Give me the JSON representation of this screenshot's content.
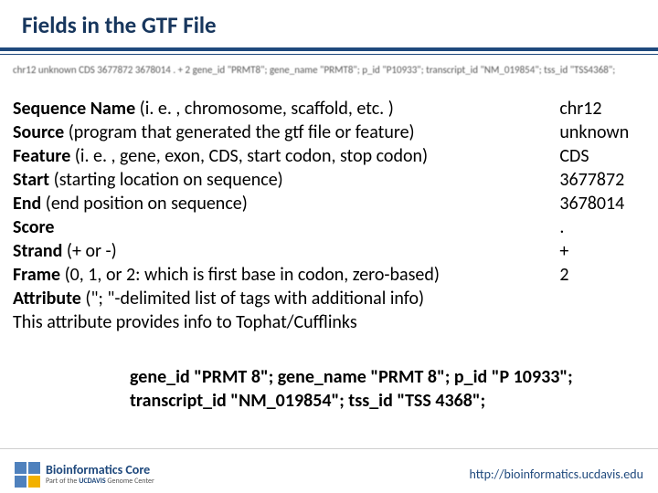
{
  "title": "Fields in the GTF File",
  "example_row": "chr12    unknown  CDS      3677872   3678014   .    +    2    gene_id \"PRMT8\"; gene_name \"PRMT8\"; p_id \"P10933\"; transcript_id \"NM_019854\"; tss_id \"TSS4368\";",
  "fields": [
    {
      "name": "Sequence Name",
      "desc": " (i. e. , chromosome, scaffold, etc. )",
      "value": "chr12"
    },
    {
      "name": "Source",
      "desc": " (program that generated the gtf file or feature)",
      "value": "unknown"
    },
    {
      "name": "Feature",
      "desc": " (i. e. , gene, exon, CDS, start codon, stop codon)",
      "value": "CDS"
    },
    {
      "name": "Start",
      "desc": " (starting location on sequence)",
      "value": "3677872"
    },
    {
      "name": "End",
      "desc": " (end position on sequence)",
      "value": "3678014"
    },
    {
      "name": "Score",
      "desc": "",
      "value": "."
    },
    {
      "name": "Strand",
      "desc": " (+ or -)",
      "value": "+"
    },
    {
      "name": "Frame",
      "desc": " (0, 1, or 2: which is first base in codon, zero-based)",
      "value": "2"
    },
    {
      "name": "Attribute",
      "desc": " (\"; \"-delimited list of tags with additional info)",
      "value": ""
    }
  ],
  "attribute_note": "This attribute provides info to Tophat/Cufflinks",
  "attribute_block_line1": "gene_id \"PRMT 8\"; gene_name \"PRMT 8\"; p_id \"P 10933\";",
  "attribute_block_line2": "transcript_id \"NM_019854\"; tss_id \"TSS 4368\";",
  "footer": {
    "logo_line1": "Bioinformatics Core",
    "logo_line2_a": "Part of the ",
    "logo_line2_b": "UCDAVIS",
    "logo_line2_c": " Genome Center",
    "url": "http://bioinformatics.ucdavis.edu"
  }
}
